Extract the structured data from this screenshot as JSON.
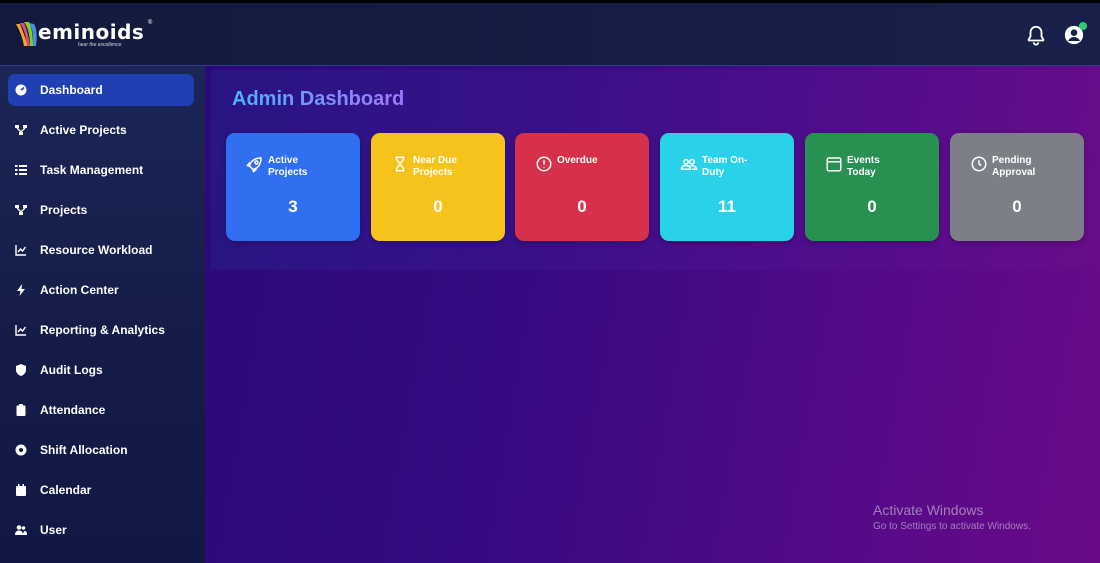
{
  "brand": {
    "name": "eminoids",
    "tagline": "hear the excellence",
    "trademark": "®"
  },
  "header": {
    "notification_icon": "bell-icon",
    "profile_icon": "user-circle-icon",
    "online_status_color": "#2ecc71"
  },
  "sidebar": {
    "items": [
      {
        "label": "Dashboard",
        "icon": "dashboard-icon",
        "active": true
      },
      {
        "label": "Active Projects",
        "icon": "project-tree-icon"
      },
      {
        "label": "Task Management",
        "icon": "task-list-icon"
      },
      {
        "label": "Projects",
        "icon": "project-tree-icon"
      },
      {
        "label": "Resource Workload",
        "icon": "chart-line-icon"
      },
      {
        "label": "Action Center",
        "icon": "bolt-icon"
      },
      {
        "label": "Reporting & Analytics",
        "icon": "chart-line-icon"
      },
      {
        "label": "Audit Logs",
        "icon": "shield-icon"
      },
      {
        "label": "Attendance",
        "icon": "clipboard-icon"
      },
      {
        "label": "Shift Allocation",
        "icon": "cog-icon"
      },
      {
        "label": "Calendar",
        "icon": "calendar-icon"
      },
      {
        "label": "User",
        "icon": "users-icon"
      }
    ]
  },
  "main": {
    "title": "Admin Dashboard",
    "cards": [
      {
        "label": "Active Projects",
        "value": "3",
        "icon": "rocket-icon",
        "color": "#2f6ff0"
      },
      {
        "label": "Near Due Projects",
        "value": "0",
        "icon": "hourglass-icon",
        "color": "#f6c31c"
      },
      {
        "label": "Overdue",
        "value": "0",
        "icon": "alert-circle-icon",
        "color": "#d7304a"
      },
      {
        "label": "Team On-Duty",
        "value": "11",
        "icon": "team-icon",
        "color": "#29d2e8"
      },
      {
        "label": "Events Today",
        "value": "0",
        "icon": "calendar-event-icon",
        "color": "#289152"
      },
      {
        "label": "Pending Approval",
        "value": "0",
        "icon": "clock-icon",
        "color": "#7d7f86"
      }
    ]
  },
  "watermark": {
    "title": "Activate Windows",
    "subtitle": "Go to Settings to activate Windows."
  },
  "colors": {
    "accent": "#1f3fb3",
    "title_gradient_start": "#4cb0ff",
    "title_gradient_end": "#a277ff"
  }
}
